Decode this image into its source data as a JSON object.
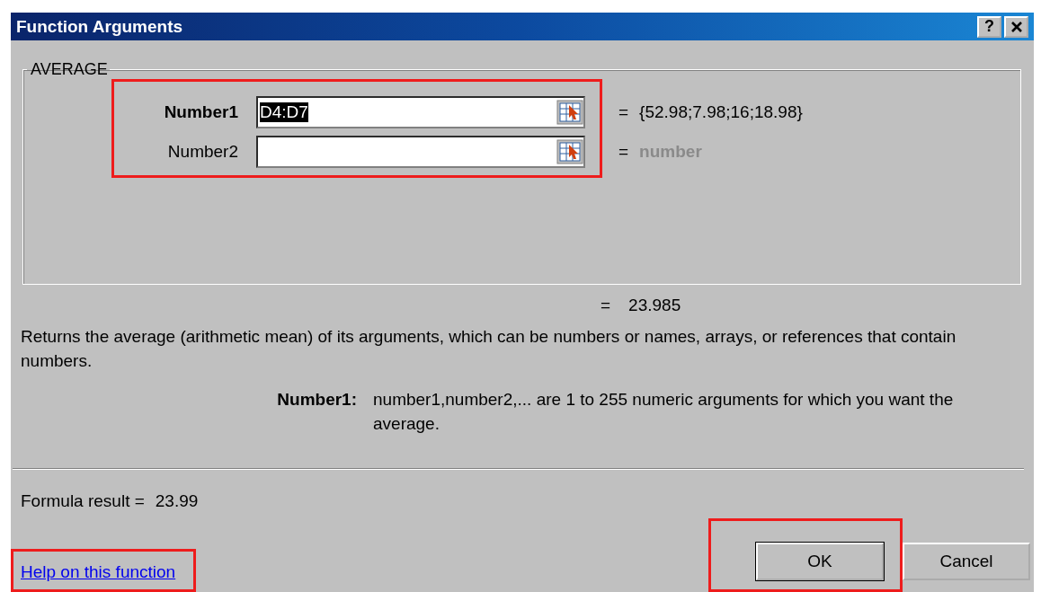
{
  "window": {
    "title": "Function Arguments",
    "help_button": "?"
  },
  "function_group": {
    "name": "AVERAGE",
    "highlighted": true,
    "arguments": [
      {
        "label": "Number1",
        "active": true,
        "value": "D4:D7",
        "selected": true,
        "result": "{52.98;7.98;16;18.98}",
        "hint": false
      },
      {
        "label": "Number2",
        "active": false,
        "result": "number",
        "hint": true
      }
    ]
  },
  "equals": "=",
  "function_result": "23.985",
  "description": "Returns the average (arithmetic mean) of its arguments, which can be numbers or names, arrays, or references that contain numbers.",
  "argument_help": {
    "label": "Number1:",
    "text": "number1,number2,... are 1 to 255 numeric arguments for which you want the average."
  },
  "formula_result": {
    "label": "Formula result =",
    "value": "23.99"
  },
  "help_link": {
    "label": "Help on this function",
    "highlighted": true
  },
  "buttons": [
    {
      "label": "OK",
      "default": true,
      "highlighted": true
    },
    {
      "label": "Cancel",
      "default": false,
      "highlighted": false
    }
  ]
}
